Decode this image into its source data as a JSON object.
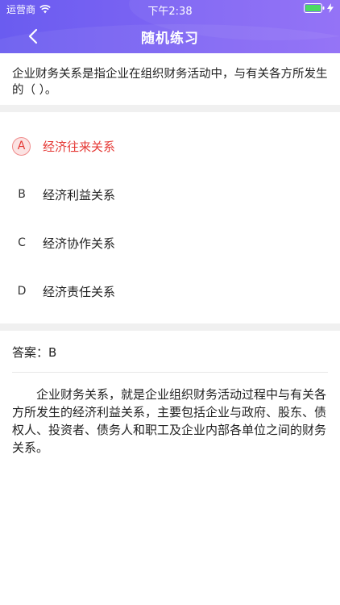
{
  "status_bar": {
    "carrier": "运营商",
    "time": "下午2:38"
  },
  "nav": {
    "title": "随机练习"
  },
  "question": {
    "text": "企业财务关系是指企业在组织财务活动中，与有关各方所发生的（   ）。"
  },
  "options": [
    {
      "letter": "A",
      "text": "经济往来关系",
      "selected": true
    },
    {
      "letter": "B",
      "text": "经济利益关系",
      "selected": false
    },
    {
      "letter": "C",
      "text": "经济协作关系",
      "selected": false
    },
    {
      "letter": "D",
      "text": "经济责任关系",
      "selected": false
    }
  ],
  "answer": {
    "label": "答案：B"
  },
  "explanation": {
    "text": "企业财务关系，就是企业组织财务活动过程中与有关各方所发生的经济利益关系，主要包括企业与政府、股东、债权人、投资者、债务人和职工及企业内部各单位之间的财务关系。"
  },
  "colors": {
    "header_start": "#6a5cf0",
    "header_end": "#8f6cf6",
    "selected_red": "#e53935",
    "separator": "#f0f0f0"
  }
}
